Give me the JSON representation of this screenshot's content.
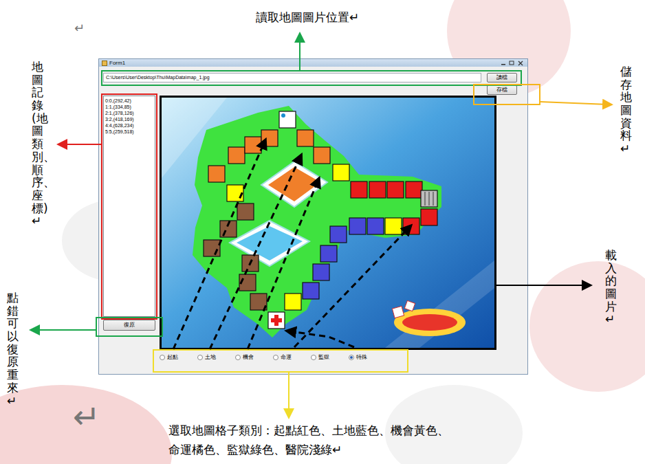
{
  "window": {
    "title": "Form1"
  },
  "path_field": {
    "value": "C:\\Users\\User\\Desktop\\Thu\\MapData\\map_1.jpg"
  },
  "buttons": {
    "load": "讀檔",
    "save": "存檔",
    "undo": "復原"
  },
  "map_records": [
    "0:0,(292,42)",
    "1:1,(334,85)",
    "2:1,(378,126)",
    "3:2,(418,169)",
    "4:4,(628,234)",
    "5:5,(259,518)"
  ],
  "tile_types": [
    {
      "label": "起點",
      "selected": false
    },
    {
      "label": "土地",
      "selected": false
    },
    {
      "label": "機會",
      "selected": false
    },
    {
      "label": "命運",
      "selected": false
    },
    {
      "label": "監獄",
      "selected": false
    },
    {
      "label": "特殊",
      "selected": true
    }
  ],
  "callouts": {
    "load": {
      "text": "讀取地圖圖片位置↵",
      "color": "#1aa64b"
    },
    "records": {
      "text": "地圖記錄(地圖類別、順序、座標)↵",
      "color": "#e0201e"
    },
    "undo": {
      "text": "點錯可以復原重來↵",
      "color": "#1aa64b"
    },
    "save": {
      "text": "儲存地圖資料↵",
      "color": "#f5b51c"
    },
    "image": {
      "text": "載入的圖片↵",
      "color": "#000000"
    },
    "types": {
      "lines": [
        "選取地圖格子類別：起點紅色、土地藍色、機會黃色、",
        "命運橘色、監獄綠色、醫院淺綠↵"
      ],
      "color": "#f0dc2a"
    }
  },
  "return_marks": [
    "↵",
    "↵"
  ]
}
